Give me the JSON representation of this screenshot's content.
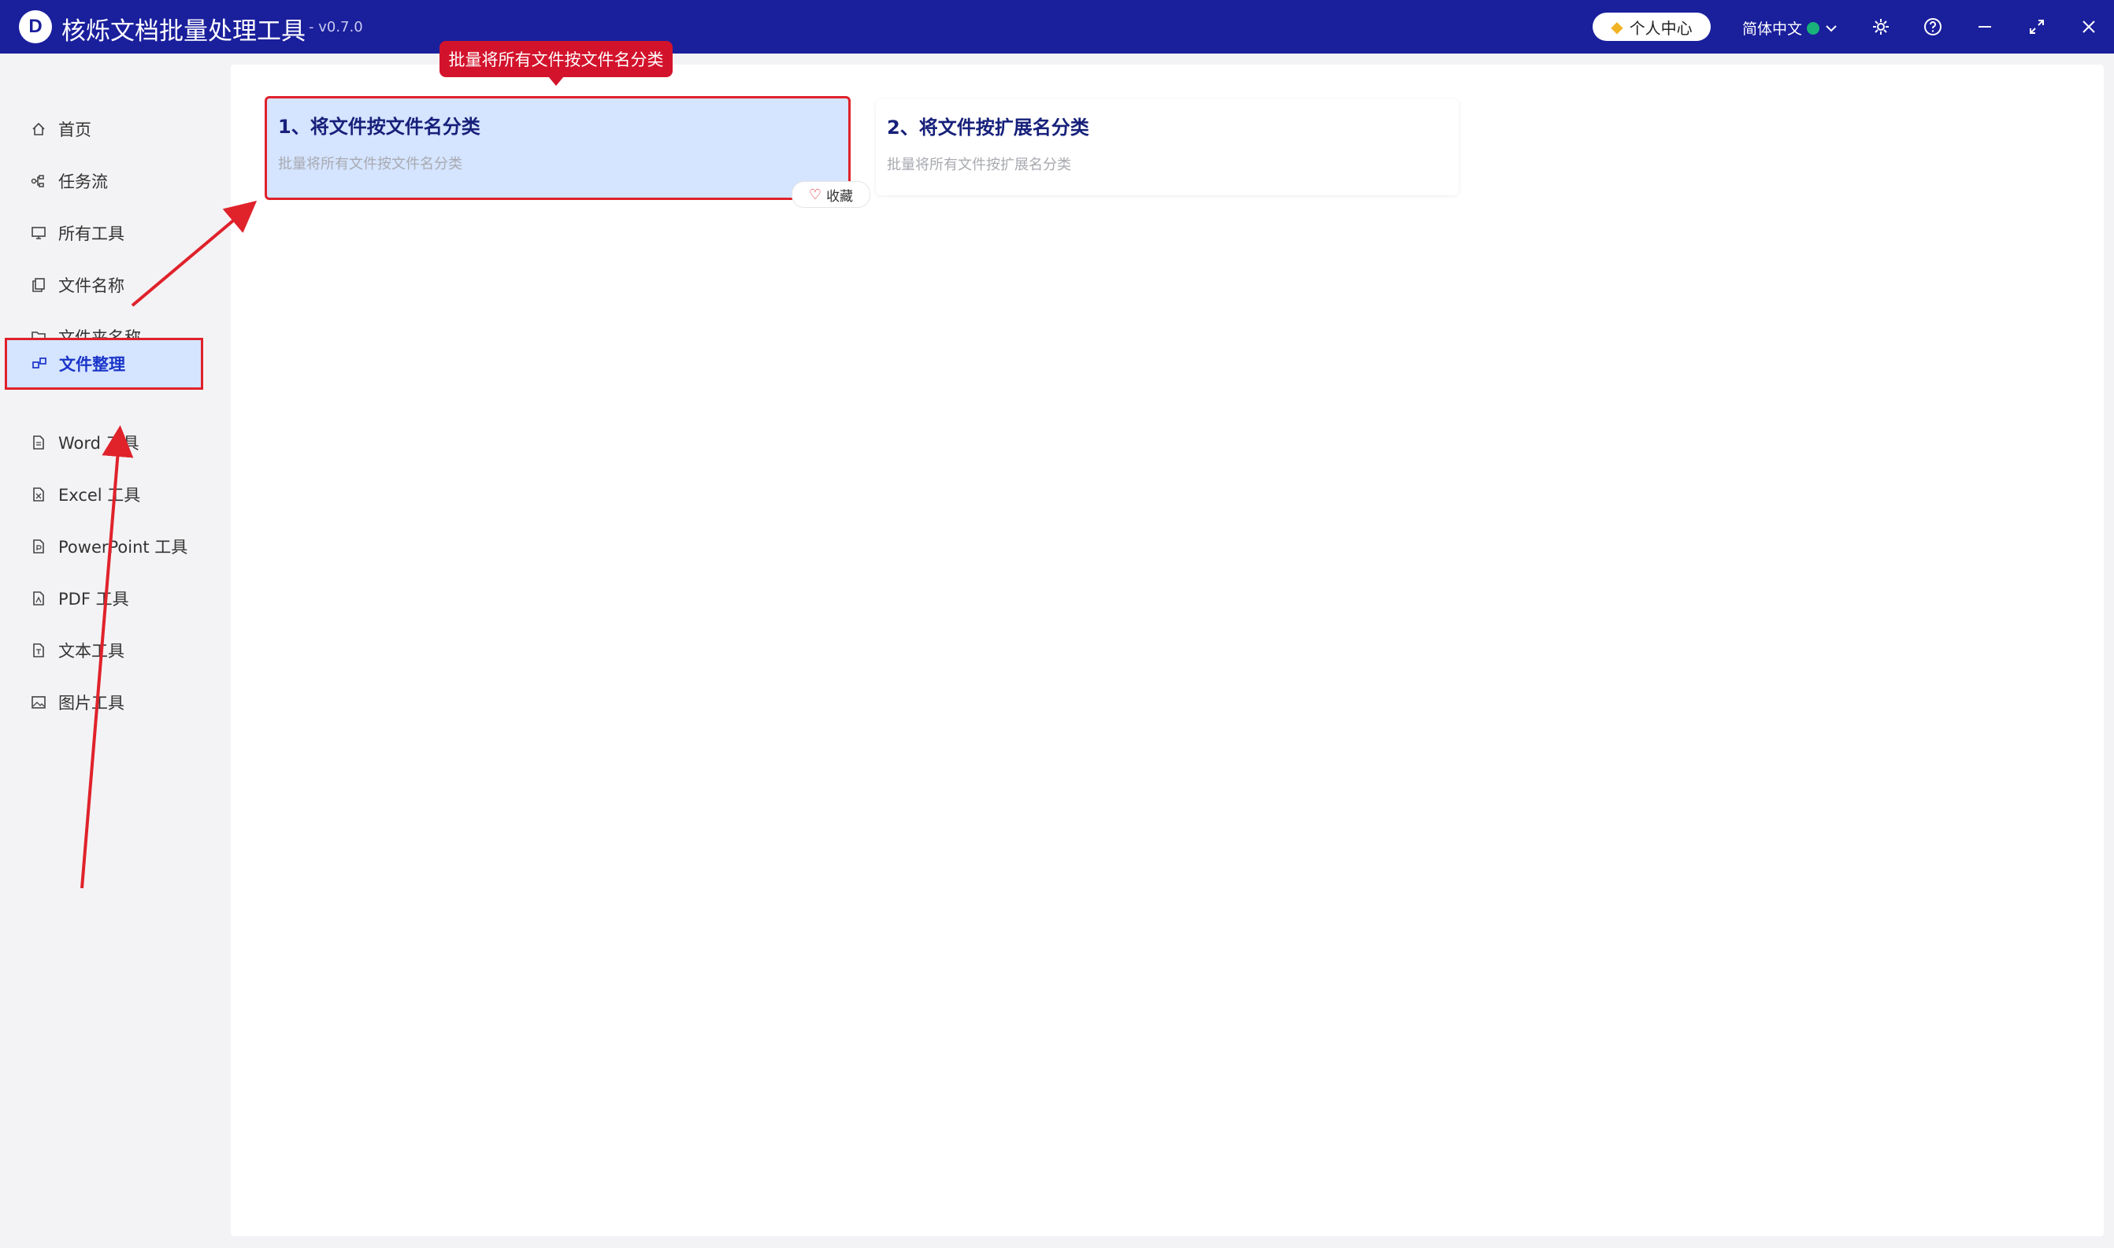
{
  "app": {
    "title": "核烁文档批量处理工具",
    "version": "- v0.7.0",
    "logo_letter": "D"
  },
  "titlebar": {
    "vip_label": "个人中心",
    "vip_icon": "diamond-icon",
    "language": "简体中文",
    "icons": [
      "globe-icon",
      "chevron-down-icon",
      "gear-icon",
      "help-icon",
      "minimize-icon",
      "maximize-icon",
      "close-icon"
    ]
  },
  "sidebar": {
    "items": [
      {
        "label": "首页",
        "icon": "home-icon"
      },
      {
        "label": "任务流",
        "icon": "workflow-icon"
      },
      {
        "label": "所有工具",
        "icon": "monitor-icon"
      },
      {
        "label": "文件名称",
        "icon": "copy-icon"
      },
      {
        "label": "文件夹名称",
        "icon": "folder-icon"
      },
      {
        "label": "文件整理",
        "icon": "organize-icon",
        "active": true
      },
      {
        "label": "Word 工具",
        "icon": "document-icon"
      },
      {
        "label": "Excel 工具",
        "icon": "document-icon"
      },
      {
        "label": "PowerPoint 工具",
        "icon": "document-icon"
      },
      {
        "label": "PDF 工具",
        "icon": "document-icon"
      },
      {
        "label": "文本工具",
        "icon": "document-icon"
      },
      {
        "label": "图片工具",
        "icon": "image-icon"
      }
    ]
  },
  "tooltip": {
    "text": "批量将所有文件按文件名分类"
  },
  "cards": [
    {
      "title": "1、将文件按文件名分类",
      "desc": "批量将所有文件按文件名分类",
      "highlighted": true
    },
    {
      "title": "2、将文件按扩展名分类",
      "desc": "批量将所有文件按扩展名分类",
      "highlighted": false
    }
  ],
  "favorite": {
    "label": "收藏",
    "icon": "heart-icon"
  },
  "colors": {
    "titlebar": "#1a1f9c",
    "accent": "#1a35c8",
    "highlight": "#e0222b",
    "active_bg": "#d5e4ff"
  }
}
